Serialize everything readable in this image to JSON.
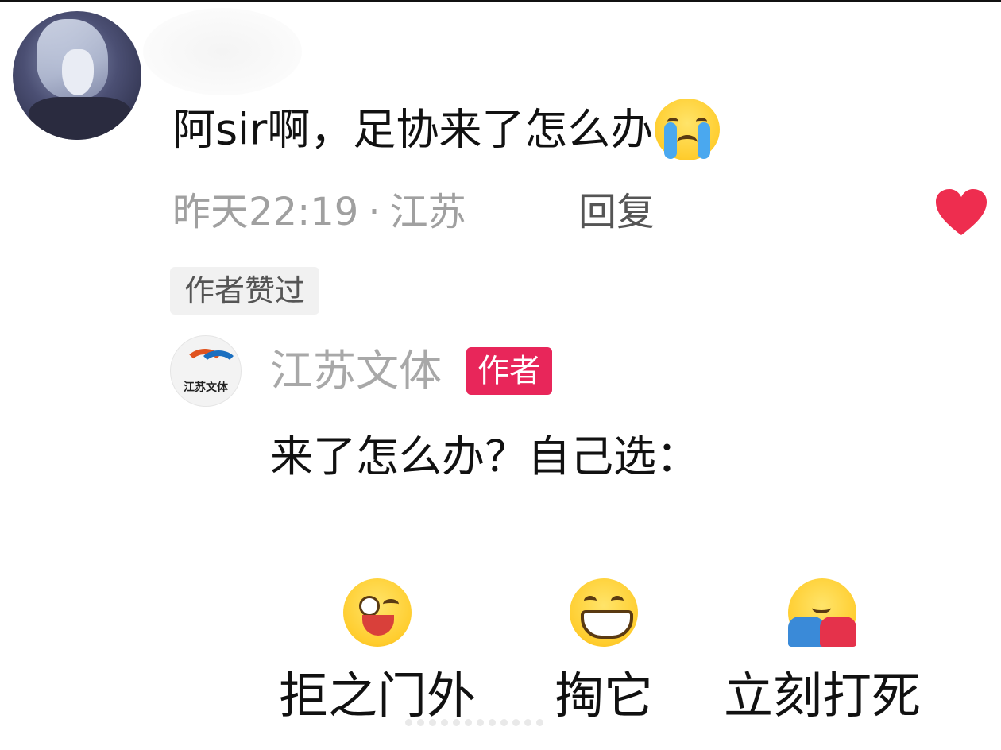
{
  "comment": {
    "text": "阿sir啊，足协来了怎么办",
    "emoji": "loudly-crying-face",
    "timestamp": "昨天22:19",
    "separator": "·",
    "location": "江苏",
    "reply_label": "回复",
    "liked_badge": "作者赞过",
    "like_icon": "heart-icon",
    "like_color": "#ee2d4f"
  },
  "author_reply": {
    "author_name": "江苏文体",
    "author_tag": "作者",
    "author_tag_color": "#e8265a",
    "avatar_logo_text": "江苏文体",
    "text": "来了怎么办？自己选：",
    "options": [
      {
        "emoji": "winking-face-with-tongue",
        "label": "拒之门外"
      },
      {
        "emoji": "grinning-face",
        "label": "掏它"
      },
      {
        "emoji": "hugging-face",
        "label": "立刻打死"
      }
    ]
  }
}
